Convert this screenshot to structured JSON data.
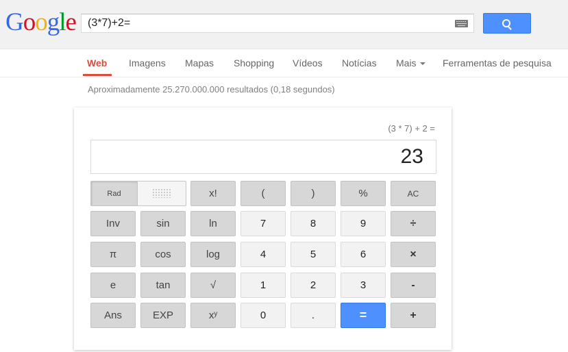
{
  "logo": {
    "letters": [
      "G",
      "o",
      "o",
      "g",
      "l",
      "e"
    ],
    "colors": [
      "#3369e8",
      "#d50f25",
      "#eeb211",
      "#3369e8",
      "#009925",
      "#d50f25"
    ]
  },
  "search": {
    "query": "(3*7)+2="
  },
  "nav": {
    "items": [
      "Web",
      "Imagens",
      "Mapas",
      "Shopping",
      "Vídeos",
      "Notícias",
      "Mais",
      "Ferramentas de pesquisa"
    ],
    "active": "Web",
    "accent": "#dd4b39"
  },
  "stats": "Aproximadamente 25.270.000.000 resultados (0,18 segundos)",
  "calc": {
    "expression": "(3 * 7) + 2 =",
    "result": "23",
    "rad_label": "Rad",
    "keys": [
      "x!",
      "(",
      ")",
      "%",
      "AC",
      "Inv",
      "sin",
      "ln",
      "7",
      "8",
      "9",
      "÷",
      "π",
      "cos",
      "log",
      "4",
      "5",
      "6",
      "×",
      "e",
      "tan",
      "√",
      "1",
      "2",
      "3",
      "-",
      "Ans",
      "EXP",
      "xʸ",
      "0",
      ".",
      "=",
      "+"
    ],
    "equals_color": "#4d90fe"
  }
}
